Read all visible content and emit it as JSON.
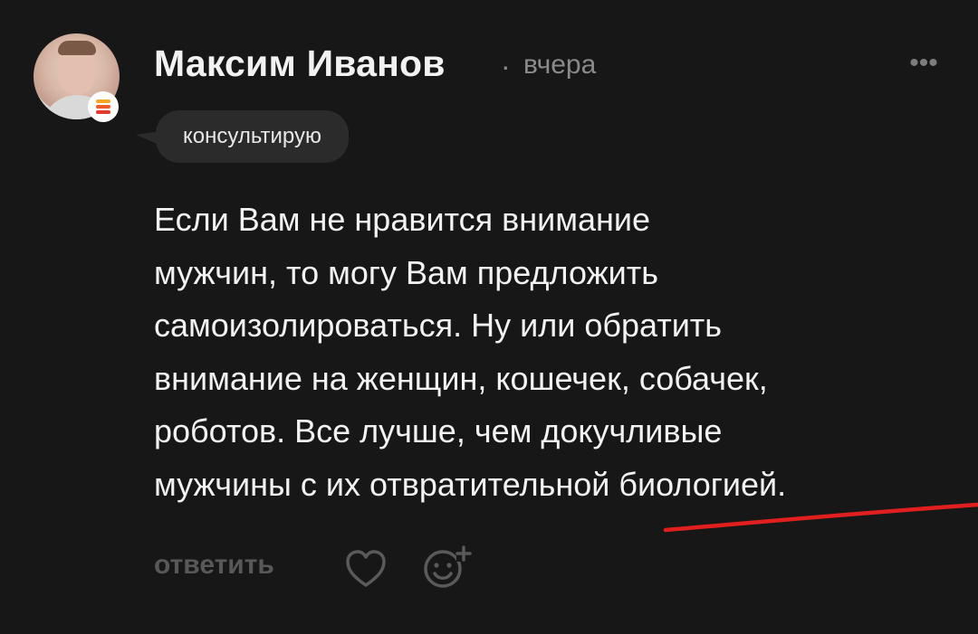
{
  "comment": {
    "author": "Максим Иванов",
    "separator": "·",
    "time": "вчера",
    "more_label": "•••",
    "tag": "консультирую",
    "text_lines": [
      "Если Вам не нравится внимание",
      "мужчин, то могу Вам предложить",
      "самоизолироваться. Ну или обратить",
      "внимание на женщин, кошечек, собачек,",
      "роботов. Все лучше, чем докучливые",
      "мужчины с их отвратительной биологией."
    ],
    "actions": {
      "reply_label": "ответить",
      "like_icon": "heart-icon",
      "reaction_icon": "add-reaction-icon"
    }
  },
  "avatar": {
    "badge_colors": [
      "#f5a623",
      "#f05a28",
      "#e5392f"
    ]
  },
  "annotation": {
    "underline_color": "#e11f1f"
  }
}
